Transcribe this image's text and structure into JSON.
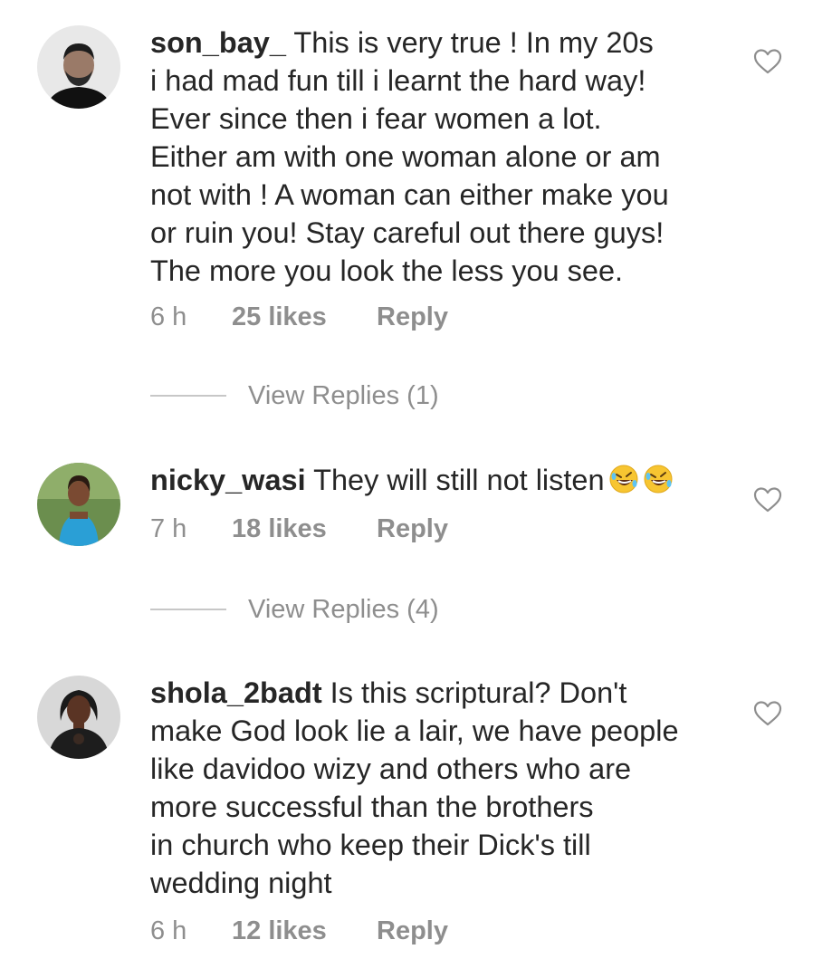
{
  "comments": [
    {
      "username": "son_bay_",
      "text": "This is very true ! In my 20s\ni had mad fun till i learnt the hard way!\nEver since then i fear women a lot.\nEither am with one woman alone or am\nnot with ! A woman can either make you\nor ruin you! Stay careful out there guys!\nThe more you look the less you see.",
      "time": "6 h",
      "likes": "25 likes",
      "reply_label": "Reply",
      "view_replies": "View Replies (1)",
      "avatar_icon": "avatar-man-bearded"
    },
    {
      "username": "nicky_wasi",
      "text": "They will still not listen",
      "emojis": [
        "rolling-on-floor-laughing-emoji",
        "rolling-on-floor-laughing-emoji"
      ],
      "time": "7 h",
      "likes": "18 likes",
      "reply_label": "Reply",
      "view_replies": "View Replies (4)",
      "avatar_icon": "avatar-woman-outdoor"
    },
    {
      "username": "shola_2badt",
      "text": "Is this scriptural? Don't\nmake God look lie a lair, we have people\nlike davidoo wizy and others who are\nmore successful than the brothers\nin church who keep their Dick's till\nwedding night",
      "time": "6 h",
      "likes": "12 likes",
      "reply_label": "Reply",
      "avatar_icon": "avatar-woman-dark"
    }
  ],
  "colors": {
    "text": "#262626",
    "secondary": "#8e8e8e",
    "divider": "#c7c7c7",
    "background": "#ffffff"
  }
}
